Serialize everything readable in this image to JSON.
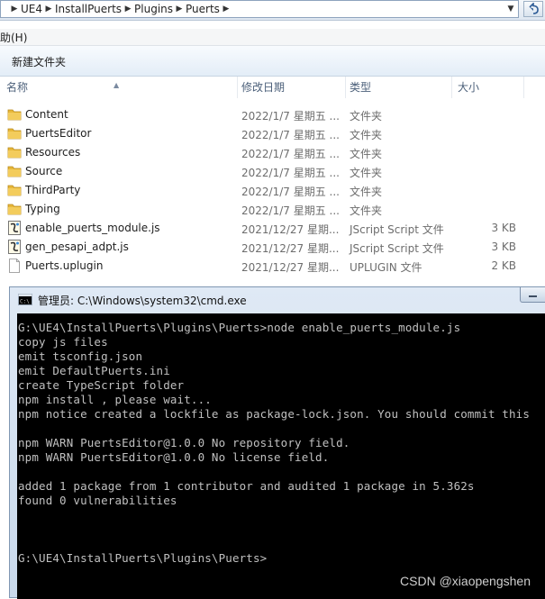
{
  "address_bar": {
    "crumbs": [
      "UE4",
      "InstallPuerts",
      "Plugins",
      "Puerts"
    ],
    "separator": "▶",
    "dropdown": "▼"
  },
  "menubar": {
    "help": "助(H)"
  },
  "commandbar": {
    "new_folder": "新建文件夹"
  },
  "list_header": {
    "name": "名称",
    "date": "修改日期",
    "type": "类型",
    "size": "大小"
  },
  "files": [
    {
      "icon": "folder-icon",
      "name": "Content",
      "date": "2022/1/7 星期五 ...",
      "type": "文件夹",
      "size": ""
    },
    {
      "icon": "folder-icon",
      "name": "PuertsEditor",
      "date": "2022/1/7 星期五 ...",
      "type": "文件夹",
      "size": ""
    },
    {
      "icon": "folder-icon",
      "name": "Resources",
      "date": "2022/1/7 星期五 ...",
      "type": "文件夹",
      "size": ""
    },
    {
      "icon": "folder-icon",
      "name": "Source",
      "date": "2022/1/7 星期五 ...",
      "type": "文件夹",
      "size": ""
    },
    {
      "icon": "folder-icon",
      "name": "ThirdParty",
      "date": "2022/1/7 星期五 ...",
      "type": "文件夹",
      "size": ""
    },
    {
      "icon": "folder-icon",
      "name": "Typing",
      "date": "2022/1/7 星期五 ...",
      "type": "文件夹",
      "size": ""
    },
    {
      "icon": "jscript-icon",
      "name": "enable_puerts_module.js",
      "date": "2021/12/27 星期...",
      "type": "JScript Script 文件",
      "size": "3 KB"
    },
    {
      "icon": "jscript-icon",
      "name": "gen_pesapi_adpt.js",
      "date": "2021/12/27 星期...",
      "type": "JScript Script 文件",
      "size": "3 KB"
    },
    {
      "icon": "file-icon",
      "name": "Puerts.uplugin",
      "date": "2021/12/27 星期...",
      "type": "UPLUGIN 文件",
      "size": "2 KB"
    }
  ],
  "cmd_window": {
    "title": "管理员: C:\\Windows\\system32\\cmd.exe",
    "lines": [
      "G:\\UE4\\InstallPuerts\\Plugins\\Puerts>node enable_puerts_module.js",
      "copy js files",
      "emit tsconfig.json",
      "emit DefaultPuerts.ini",
      "create TypeScript folder",
      "npm install , please wait...",
      "npm notice created a lockfile as package-lock.json. You should commit this",
      "",
      "npm WARN PuertsEditor@1.0.0 No repository field.",
      "npm WARN PuertsEditor@1.0.0 No license field.",
      "",
      "added 1 package from 1 contributor and audited 1 package in 5.362s",
      "found 0 vulnerabilities",
      "",
      "",
      "",
      "G:\\UE4\\InstallPuerts\\Plugins\\Puerts>"
    ]
  },
  "watermark": "CSDN @xiaopengshen",
  "colors": {
    "console_bg": "#000000",
    "console_text": "#c0c0c0",
    "folder": "#e8b83a"
  }
}
